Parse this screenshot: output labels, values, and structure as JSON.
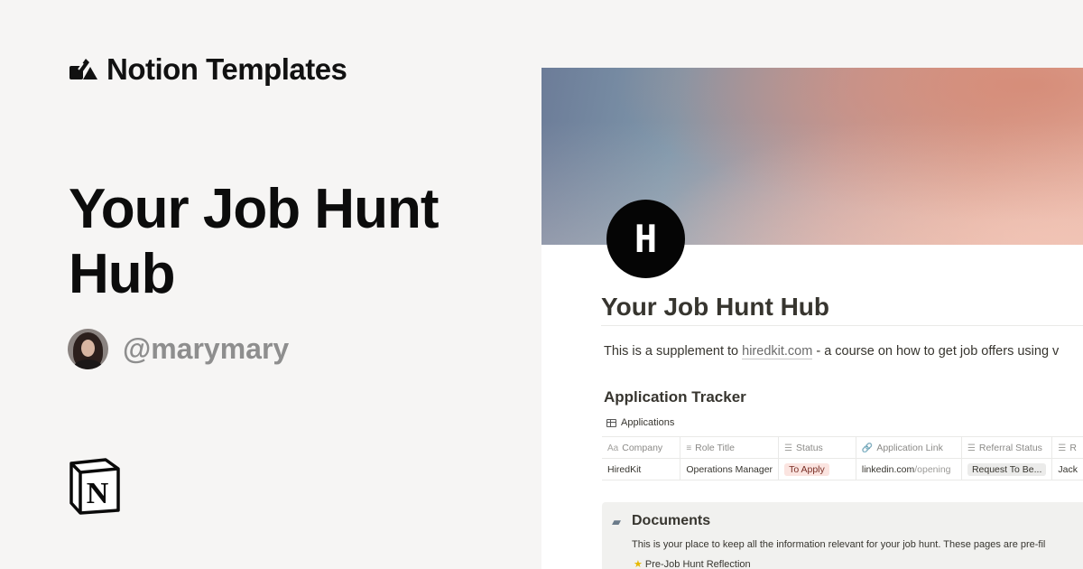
{
  "branding": {
    "site_name": "Notion Templates"
  },
  "hero": {
    "title": "Your Job Hunt Hub",
    "creator_handle": "@marymary"
  },
  "preview": {
    "page_icon_letter": "H",
    "page_title": "Your Job Hunt Hub",
    "supplement": {
      "prefix": "This is a supplement to ",
      "link_text": "hiredkit.com",
      "suffix": " - a course on how to get job offers using v"
    },
    "tracker": {
      "heading": "Application Tracker",
      "view_name": "Applications",
      "columns": [
        {
          "icon": "Aa",
          "label": "Company"
        },
        {
          "icon": "≡",
          "label": "Role Title"
        },
        {
          "icon": "☰",
          "label": "Status"
        },
        {
          "icon": "🔗",
          "label": "Application Link"
        },
        {
          "icon": "☰",
          "label": "Referral Status"
        },
        {
          "icon": "☰",
          "label": "R"
        }
      ],
      "rows": [
        {
          "company": "HiredKit",
          "role": "Operations Manager",
          "status": "To Apply",
          "link_main": "linkedin.com",
          "link_rest": "/opening",
          "referral": "Request To Be...",
          "referrer": "Jack"
        }
      ]
    },
    "documents": {
      "icon": "folder-icon",
      "title": "Documents",
      "description": "This is your place to keep all the information relevant for your job hunt. These pages are pre-fil",
      "item": "Pre-Job Hunt Reflection"
    }
  },
  "colors": {
    "status_tag_bg": "#fbe4e0",
    "page_icon_bg": "#050505",
    "handle_gray": "#8e8e8e"
  }
}
